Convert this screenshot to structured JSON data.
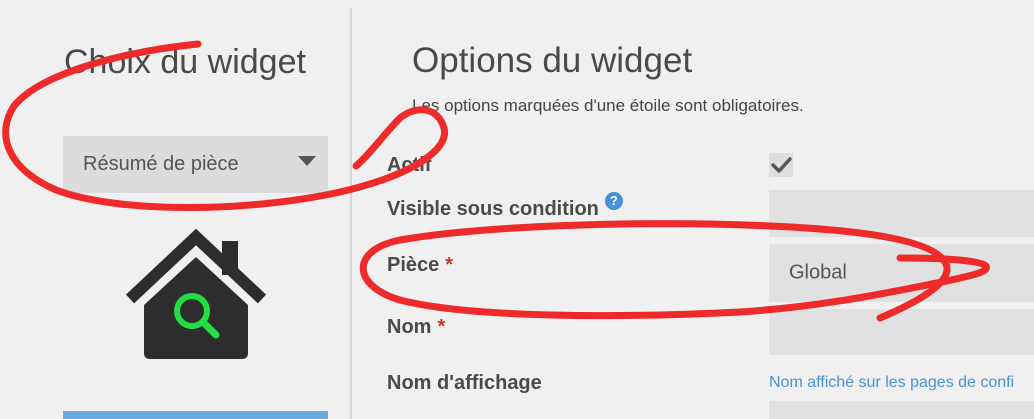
{
  "left": {
    "title": "Choix du widget",
    "select": {
      "selected": "Résumé de pièce"
    }
  },
  "right": {
    "title": "Options du widget",
    "required_note": "Les options marquées d'une étoile sont obligatoires.",
    "fields": {
      "actif": {
        "label": "Actif",
        "checked": true
      },
      "visible": {
        "label": "Visible sous condition",
        "help": "?"
      },
      "piece": {
        "label": "Pièce",
        "required": "*",
        "value": "Global"
      },
      "nom": {
        "label": "Nom",
        "required": "*",
        "value": ""
      },
      "nom_affichage": {
        "label": "Nom d'affichage",
        "hint": "Nom affiché sur les pages de confi"
      }
    }
  },
  "colors": {
    "annotation": "#ee2a2a",
    "accent_blue": "#4a90d9",
    "icon_green": "#22dd44",
    "icon_dark": "#2d2d2d"
  },
  "icons": {
    "widget": "house-search-icon",
    "select_arrow": "caret-down-icon",
    "check": "check-icon"
  }
}
